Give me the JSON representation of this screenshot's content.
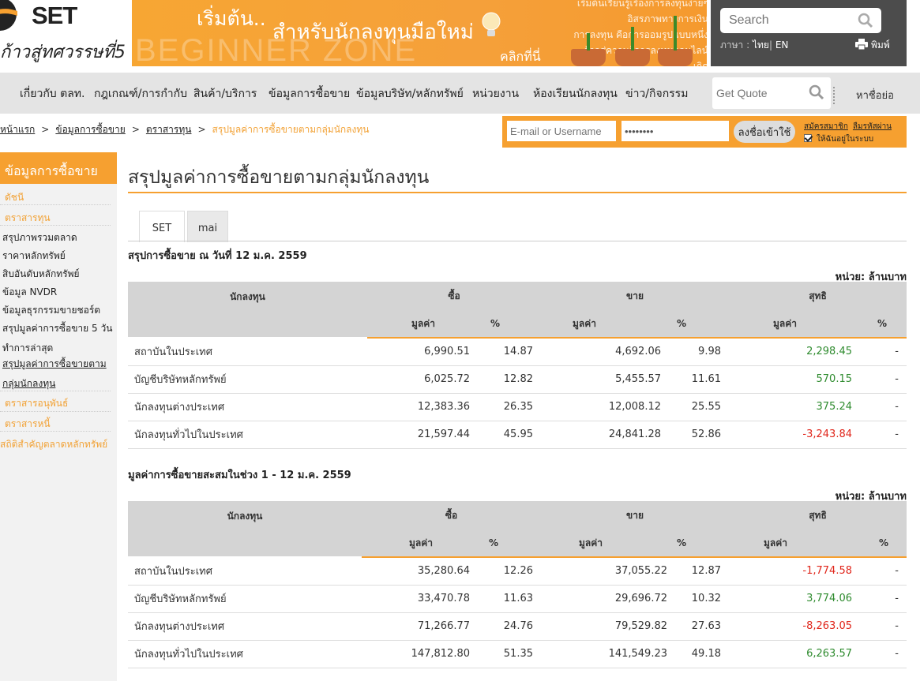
{
  "header": {
    "logo_text": "SET",
    "slogan": "ก้าวสู่ทศวรรษที่5",
    "banner": {
      "title_start": "เริ่มต้น..",
      "title_main": "สำหรับนักลงทุนมือใหม่",
      "click": "คลิกที่นี่",
      "zone": "BEGINNER ZONE",
      "side_text": [
        "เริ่มต้นเรียนรู้เรื่องการลงทุนง่ายๆ",
        "อิสรภาพทางการเงิน",
        "การลงทุน คือการออมรูปแบบหนึ่ง",
        "ก้าวสู่ความรู้การลงทุนออนไลน์",
        "เกิด"
      ]
    },
    "search_placeholder": "Search",
    "language_label": "ภาษา :",
    "lang_th": "ไทย",
    "lang_sep": "|",
    "lang_en": "EN",
    "print_label": "พิมพ์"
  },
  "nav": {
    "items": [
      "เกี่ยวกับ ตลท.",
      "กฎเกณฑ์/การกำกับ",
      "สินค้า/บริการ",
      "ข้อมูลการซื้อขาย",
      "ข้อมูลบริษัท/หลักทรัพย์",
      "หน่วยงาน",
      "ห้องเรียนนักลงทุน",
      "ข่าว/กิจกรรม"
    ],
    "quote_placeholder": "Get Quote",
    "abbr_label": "หาชื่อย่อ"
  },
  "breadcrumb": {
    "items": [
      "หน้าแรก",
      "ข้อมูลการซื้อขาย",
      "ตราสารทุน"
    ],
    "current": "สรุปมูลค่าการซื้อขายตามกลุ่มนักลงทุน",
    "sep": ">"
  },
  "login": {
    "user_placeholder": "E-mail or Username",
    "password_value": "••••••••",
    "button": "ลงชื่อเข้าใช้",
    "register": "สมัครสมาชิก",
    "forgot": "ลืมรหัสผ่าน",
    "remember": "ให้ฉันอยู่ในระบบ"
  },
  "sidebar": {
    "title": "ข้อมูลการซื้อขาย",
    "section_index": "ดัชนี",
    "section_equity": "ตราสารทุน",
    "sub_items": [
      "สรุปภาพรวมตลาด",
      "ราคาหลักทรัพย์",
      "สิบอันดับหลักทรัพย์",
      "ข้อมูล NVDR",
      "ข้อมูลธุรกรรมขายชอร์ต"
    ],
    "five_day_1": "สรุปมูลค่าการซื้อขาย 5 วัน",
    "five_day_2": "ทำการล่าสุด",
    "active_1": "สรุปมูลค่าการซื้อขายตาม",
    "active_2": "กลุ่มนักลงทุน",
    "section_derivatives": "ตราสารอนุพันธ์",
    "section_bonds": "ตราสารหนี้",
    "section_stats": "สถิติสำคัญตลาดหลักทรัพย์"
  },
  "main": {
    "title": "สรุปมูลค่าการซื้อขายตามกลุ่มนักลงทุน",
    "tabs": [
      "SET",
      "mai"
    ],
    "unit": "หน่วย: ล้านบาท",
    "headers": {
      "investor": "นักลงทุน",
      "buy": "ซื้อ",
      "sell": "ขาย",
      "net": "สุทธิ",
      "value": "มูลค่า",
      "pct": "%"
    },
    "table1": {
      "title": "สรุปการซื้อขาย ณ วันที่ 12 ม.ค. 2559",
      "rows": [
        {
          "name": "สถาบันในประเทศ",
          "buy": "6,990.51",
          "buy_pct": "14.87",
          "sell": "4,692.06",
          "sell_pct": "9.98",
          "net": "2,298.45",
          "net_pct": "-",
          "sign": "pos"
        },
        {
          "name": "บัญชีบริษัทหลักทรัพย์",
          "buy": "6,025.72",
          "buy_pct": "12.82",
          "sell": "5,455.57",
          "sell_pct": "11.61",
          "net": "570.15",
          "net_pct": "-",
          "sign": "pos"
        },
        {
          "name": "นักลงทุนต่างประเทศ",
          "buy": "12,383.36",
          "buy_pct": "26.35",
          "sell": "12,008.12",
          "sell_pct": "25.55",
          "net": "375.24",
          "net_pct": "-",
          "sign": "pos"
        },
        {
          "name": "นักลงทุนทั่วไปในประเทศ",
          "buy": "21,597.44",
          "buy_pct": "45.95",
          "sell": "24,841.28",
          "sell_pct": "52.86",
          "net": "-3,243.84",
          "net_pct": "-",
          "sign": "neg"
        }
      ]
    },
    "table2": {
      "title": "มูลค่าการซื้อขายสะสมในช่วง 1 - 12 ม.ค. 2559",
      "rows": [
        {
          "name": "สถาบันในประเทศ",
          "buy": "35,280.64",
          "buy_pct": "12.26",
          "sell": "37,055.22",
          "sell_pct": "12.87",
          "net": "-1,774.58",
          "net_pct": "-",
          "sign": "neg"
        },
        {
          "name": "บัญชีบริษัทหลักทรัพย์",
          "buy": "33,470.78",
          "buy_pct": "11.63",
          "sell": "29,696.72",
          "sell_pct": "10.32",
          "net": "3,774.06",
          "net_pct": "-",
          "sign": "pos"
        },
        {
          "name": "นักลงทุนต่างประเทศ",
          "buy": "71,266.77",
          "buy_pct": "24.76",
          "sell": "79,529.82",
          "sell_pct": "27.63",
          "net": "-8,263.05",
          "net_pct": "-",
          "sign": "neg"
        },
        {
          "name": "นักลงทุนทั่วไปในประเทศ",
          "buy": "147,812.80",
          "buy_pct": "51.35",
          "sell": "141,549.23",
          "sell_pct": "49.18",
          "net": "6,263.57",
          "net_pct": "-",
          "sign": "pos"
        }
      ]
    }
  },
  "colors": {
    "accent": "#f6a030",
    "positive": "#2e8b2e",
    "negative": "#e0261b",
    "header_dark": "#4c4c4c",
    "nav_bg": "#e4e4e4"
  },
  "icons": [
    "set-logo-icon",
    "bulb-icon",
    "search-icon",
    "printer-icon",
    "checkbox-icon"
  ]
}
